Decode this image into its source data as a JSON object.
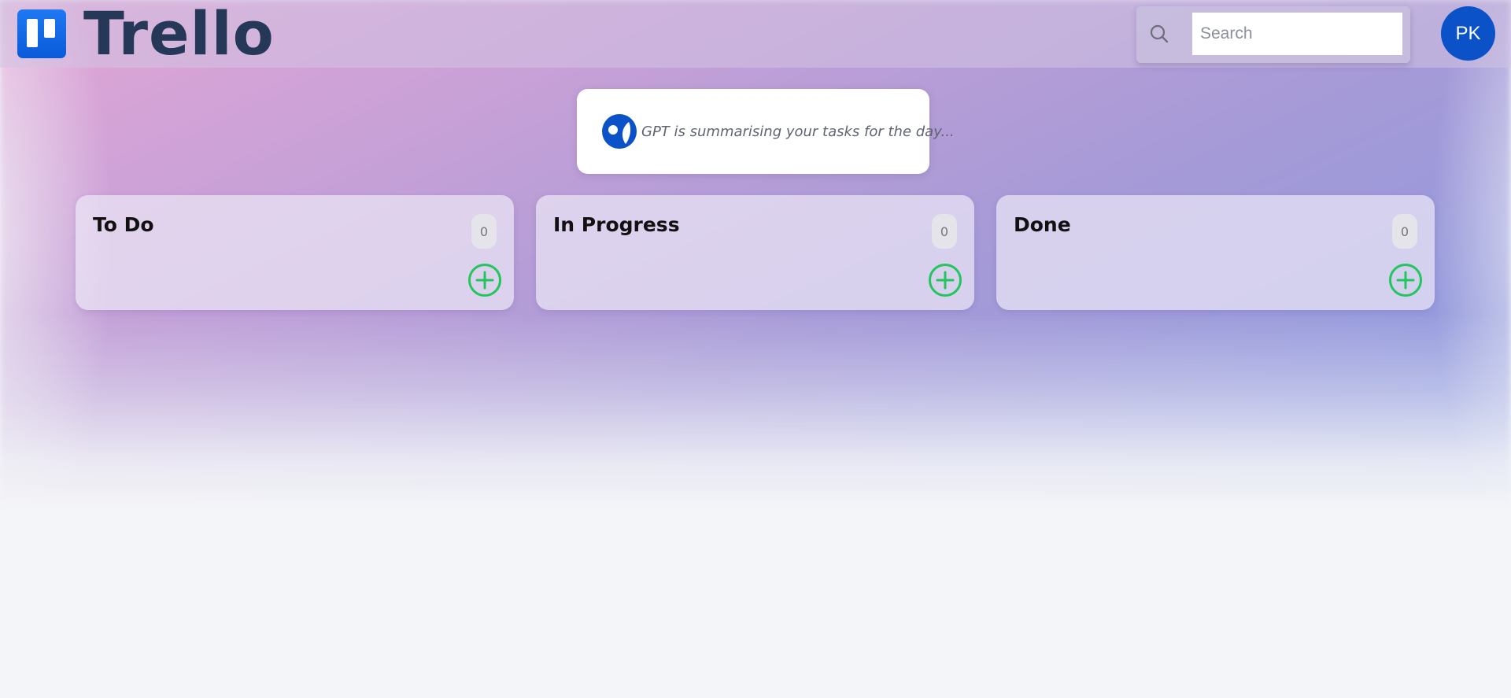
{
  "header": {
    "logo_text": "Trello",
    "search": {
      "placeholder": "Search",
      "value": ""
    },
    "avatar_initials": "PK"
  },
  "summary": {
    "text": "GPT is summarising your tasks for the day..."
  },
  "columns": [
    {
      "title": "To Do",
      "count": "0"
    },
    {
      "title": "In Progress",
      "count": "0"
    },
    {
      "title": "Done",
      "count": "0"
    }
  ],
  "colors": {
    "brand_blue": "#0b52c8",
    "logo_text": "#253858",
    "add_button": "#22c55e",
    "gradient_start": "#e3a6d6",
    "gradient_mid": "#a69ad7",
    "gradient_end": "#7f9be4"
  },
  "icons": {
    "logo": "trello-logo-icon",
    "search": "search-icon",
    "gpt": "gpt-icon",
    "add": "plus-circle-icon"
  }
}
